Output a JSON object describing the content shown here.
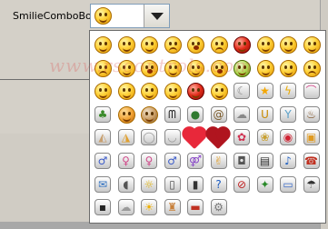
{
  "form": {
    "label": "SmilieComboBox",
    "combo_selected_icon": "smile-face-icon"
  },
  "watermark": "www.rscontrols.com",
  "emoticons": [
    "smile-face-icon",
    "wink-face-icon",
    "grin-face-icon",
    "sad-face-icon",
    "surprised-face-icon",
    "crying-face-icon",
    "angry-devil-face-icon",
    "cool-face-icon",
    "tongue-face-icon",
    "laughing-face-icon",
    "confused-face-icon",
    "embarrassed-face-icon",
    "shocked-face-icon",
    "party-face-icon",
    "thinking-face-icon",
    "sleepy-face-icon",
    "sick-face-icon",
    "kiss-face-icon",
    "smirk-face-icon",
    "annoyed-face-icon",
    "nerd-face-icon",
    "eye-roll-face-icon",
    "sarcastic-face-icon",
    "secret-face-icon",
    "devil-face-icon",
    "angel-face-icon",
    "moon-icon",
    "star-icon",
    "lightning-icon",
    "rainbow-icon",
    "island-palm-icon",
    "cat-face-icon",
    "dog-face-icon",
    "bat-icon",
    "turtle-icon",
    "snail-icon",
    "sheep-icon",
    "beer-mug-icon",
    "cocktail-icon",
    "coffee-cup-icon",
    "cake-slice-icon",
    "pizza-slice-icon",
    "plate-icon",
    "bowl-icon",
    "heart-icon",
    "broken-heart-icon",
    "flower-icon",
    "wilted-flower-icon",
    "lips-icon",
    "gift-icon",
    "boy-icon",
    "girl-icon",
    "woman-icon",
    "man-icon",
    "boy-girl-icon",
    "fingers-crossed-icon",
    "camera-icon",
    "film-icon",
    "music-note-icon",
    "telephone-icon",
    "email-icon",
    "computer-mouse-icon",
    "light-bulb-icon",
    "cell-phone-icon",
    "mobile-phone-icon",
    "question-icon",
    "no-sign-icon",
    "person-running-icon",
    "computer-icon",
    "umbrella-icon",
    "game-console-icon",
    "clouds-icon",
    "sun-icon",
    "birthday-cake-icon",
    "car-icon",
    "gear-icon"
  ]
}
